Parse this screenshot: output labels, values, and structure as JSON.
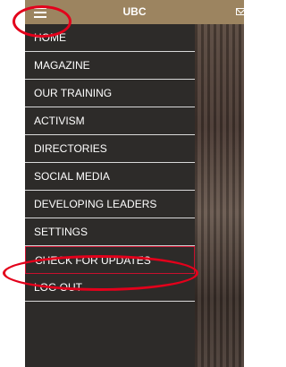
{
  "app": {
    "title": "UBC"
  },
  "icons": {
    "menu": "hamburger-menu-icon",
    "mail": "mail-icon"
  },
  "colors": {
    "topbar": "#9c8460",
    "drawer": "#2d2b29",
    "annotation": "#e3001b"
  },
  "drawer": {
    "items": [
      {
        "label": "HOME"
      },
      {
        "label": "MAGAZINE"
      },
      {
        "label": "OUR TRAINING"
      },
      {
        "label": "ACTIVISM"
      },
      {
        "label": "DIRECTORIES"
      },
      {
        "label": "SOCIAL MEDIA"
      },
      {
        "label": "DEVELOPING LEADERS"
      },
      {
        "label": "SETTINGS"
      },
      {
        "label": "CHECK FOR UPDATES",
        "highlighted": true
      },
      {
        "label": "LOG OUT"
      }
    ]
  }
}
